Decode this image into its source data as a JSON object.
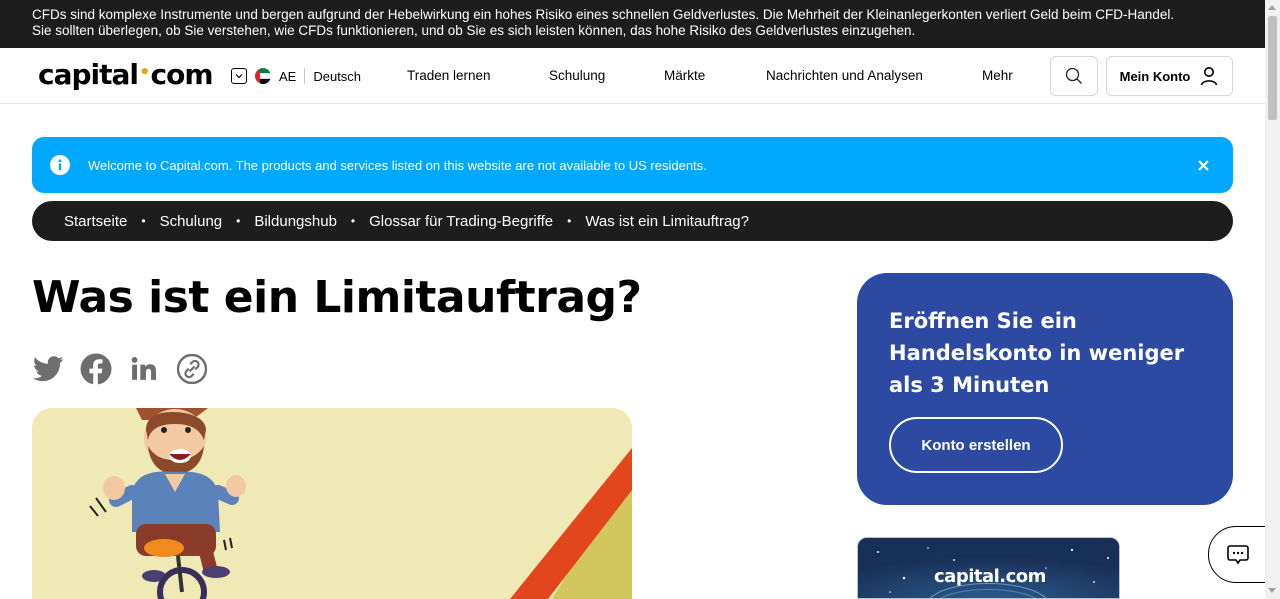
{
  "risk_warning": {
    "line1": "CFDs sind komplexe Instrumente und bergen aufgrund der Hebelwirkung ein hohes Risiko eines schnellen Geldverlustes. Die Mehrheit der Kleinanlegerkonten verliert Geld beim CFD-Handel.",
    "line2": "Sie sollten überlegen, ob Sie verstehen, wie CFDs funktionieren, und ob Sie es sich leisten können, das hohe Risiko des Geldverlustes einzugehen."
  },
  "header": {
    "logo_left": "capital",
    "logo_dot": "•",
    "logo_right": "com",
    "region_code": "AE",
    "language": "Deutsch",
    "nav": [
      "Traden lernen",
      "Schulung",
      "Märkte",
      "Nachrichten und Analysen",
      "Mehr"
    ],
    "account_label": "Mein Konto"
  },
  "banner": {
    "text": "Welcome to Capital.com. The products and services listed on this website are not available to US residents."
  },
  "breadcrumb": {
    "items": [
      "Startseite",
      "Schulung",
      "Bildungshub",
      "Glossar für Trading-Begriffe",
      "Was ist ein Limitauftrag?"
    ],
    "separator": "•"
  },
  "article": {
    "title": "Was ist ein Limitauftrag?",
    "share_icons": [
      "twitter-icon",
      "facebook-icon",
      "linkedin-icon",
      "copy-link-icon"
    ]
  },
  "promo": {
    "title": "Eröffnen Sie ein Handelskonto in weniger als 3 Minuten",
    "button": "Konto erstellen"
  },
  "app_card": {
    "logo": "capital.com"
  },
  "colors": {
    "risk_bar": "#1d1d1d",
    "banner": "#00a8ff",
    "promo": "#2d4aa3",
    "logo_dot": "#e9a11f",
    "hero_bg": "#efe9b6",
    "hero_stripe": "#e2461c"
  }
}
